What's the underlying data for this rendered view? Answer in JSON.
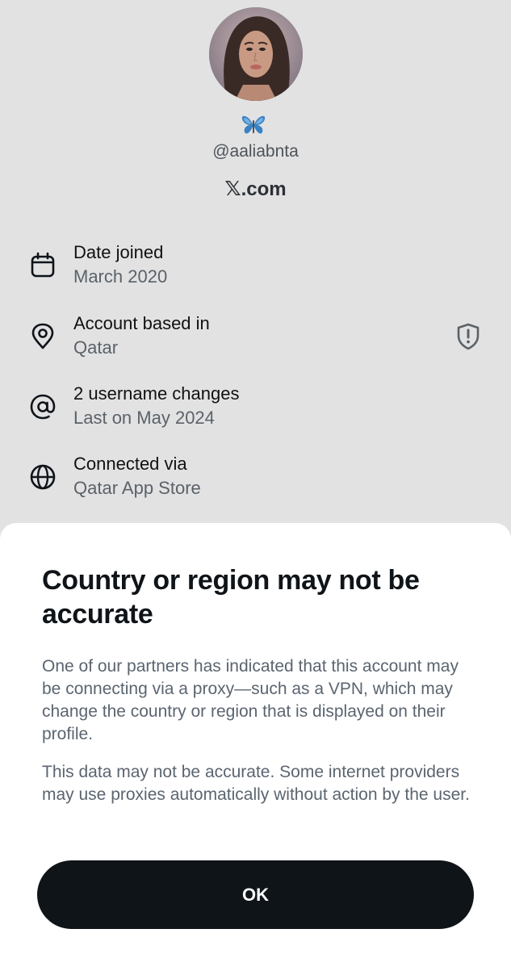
{
  "profile": {
    "handle": "@aaliabnta",
    "site": "X.com",
    "site_x": "𝕏",
    "site_rest": ".com",
    "avatar": "profile-photo",
    "badge_icon": "butterfly-emoji"
  },
  "about": {
    "items": [
      {
        "icon": "calendar-icon",
        "title": "Date joined",
        "value": "March 2020"
      },
      {
        "icon": "location-pin-icon",
        "title": "Account based in",
        "value": "Qatar"
      },
      {
        "icon": "at-sign-icon",
        "title": "2 username changes",
        "value": "Last on May 2024"
      },
      {
        "icon": "globe-icon",
        "title": "Connected via",
        "value": "Qatar App Store"
      }
    ],
    "warning_icon": "shield-alert-icon"
  },
  "sheet": {
    "title": "Country or region may not be accurate",
    "paragraph1": "One of our partners has indicated that this account may be connecting via a proxy—such as a VPN, which may change the country or region that is displayed on their profile.",
    "paragraph2": "This data may not be accurate. Some internet providers may use proxies automatically without action by the user.",
    "ok_label": "OK"
  },
  "colors": {
    "backdrop": "#e2e2e3",
    "sheet": "#ffffff",
    "button": "#0f1419",
    "muted_text": "#5b6570",
    "badge_blue": "#3b82c4"
  }
}
